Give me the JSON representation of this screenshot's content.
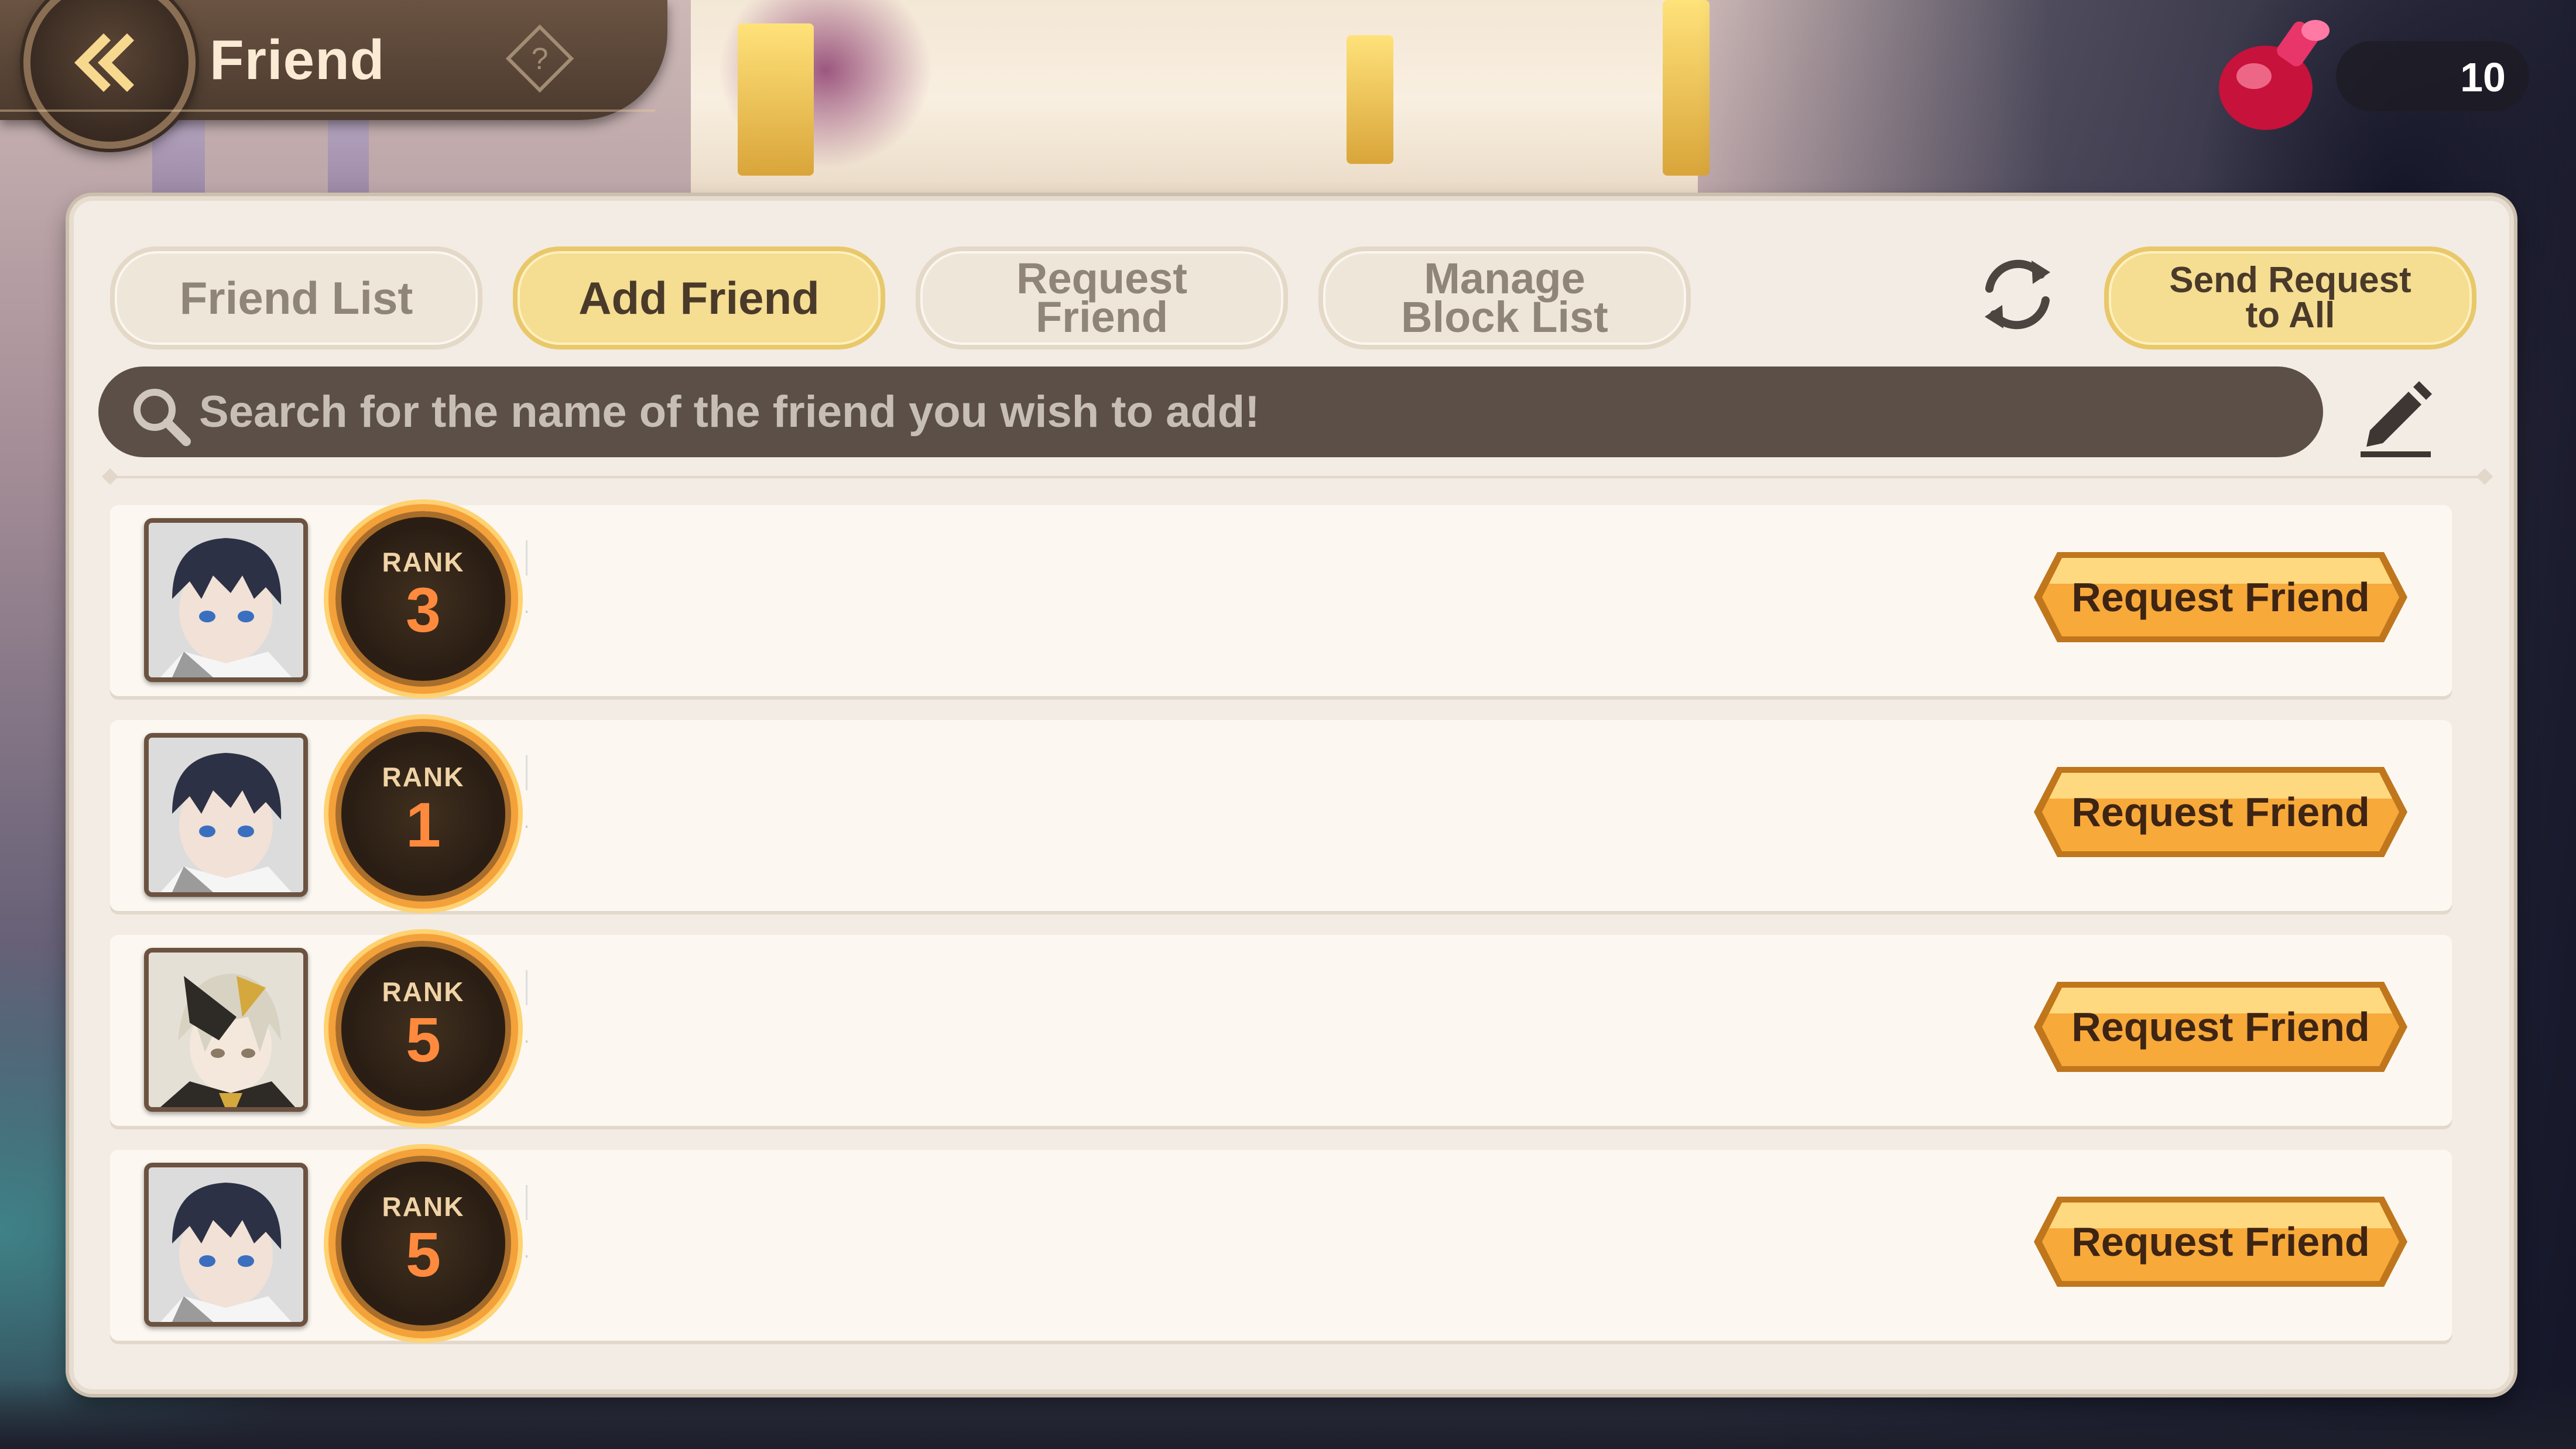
{
  "header": {
    "title": "Friend",
    "back_icon": "back-arrow-icon",
    "help_icon": "question-diamond-icon"
  },
  "currency": {
    "icon": "red-potion-icon",
    "value": "10"
  },
  "tabs": [
    {
      "label": "Friend List",
      "active": false
    },
    {
      "label": "Add Friend",
      "active": true
    },
    {
      "label": "Request Friend",
      "active": false
    },
    {
      "label": "Manage Block List",
      "active": false
    }
  ],
  "toolbar": {
    "refresh_icon": "refresh-icon",
    "send_all_label": "Send Request to All"
  },
  "search": {
    "placeholder": "Search for the name of the friend you wish to add!",
    "value": ""
  },
  "friends": [
    {
      "rank_label": "RANK",
      "rank": "3",
      "avatar": "dark-haired-boy-avatar",
      "button": "Request Friend"
    },
    {
      "rank_label": "RANK",
      "rank": "1",
      "avatar": "dark-haired-boy-avatar",
      "button": "Request Friend"
    },
    {
      "rank_label": "RANK",
      "rank": "5",
      "avatar": "armored-girl-avatar",
      "button": "Request Friend"
    },
    {
      "rank_label": "RANK",
      "rank": "5",
      "avatar": "dark-haired-boy-avatar",
      "button": "Request Friend"
    }
  ],
  "colors": {
    "panel": "#f3ece4",
    "tab_active": "#f5dd92",
    "button_orange": "#f7a93a",
    "rank_orange": "#ff8a3d"
  }
}
